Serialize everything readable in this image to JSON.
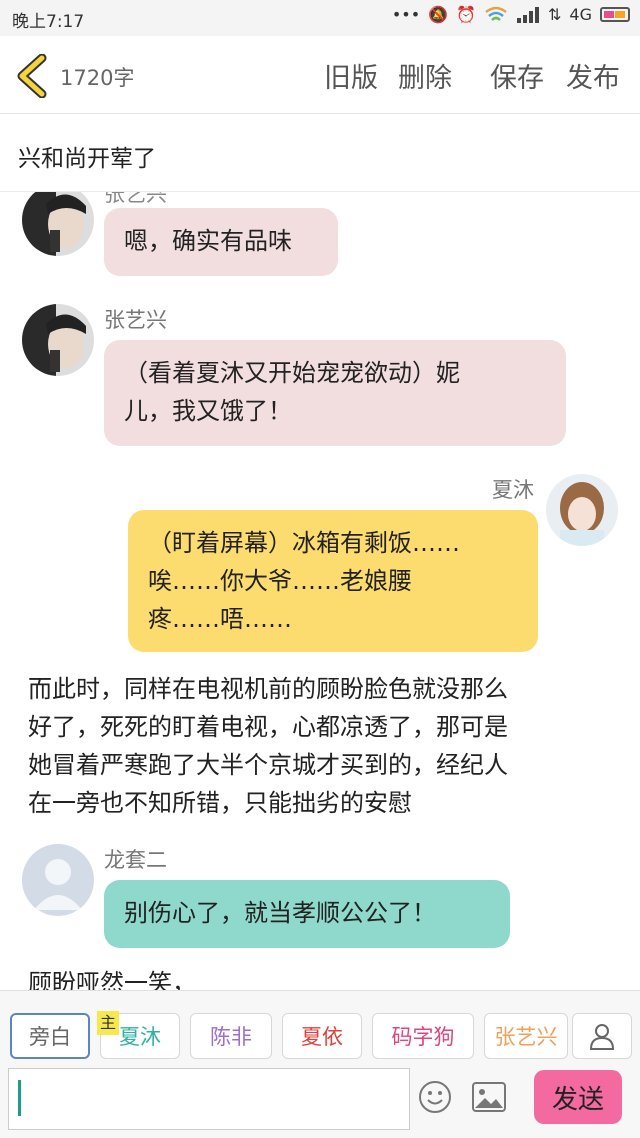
{
  "status": {
    "time": "晚上7:17",
    "network": "4G"
  },
  "header": {
    "word_count": "1720字",
    "old_version": "旧版",
    "delete": "删除",
    "save": "保存",
    "publish": "发布"
  },
  "title": "兴和尚开荤了",
  "messages": [
    {
      "type": "left",
      "speaker": "张艺兴",
      "text": "嗯，确实有品味",
      "color": "#f2dedf"
    },
    {
      "type": "left",
      "speaker": "张艺兴",
      "text_lines": [
        "（看着夏沐又开始宠宠欲动）妮",
        "儿，我又饿了！"
      ],
      "color": "#f2dedf"
    },
    {
      "type": "right",
      "speaker": "夏沐",
      "text_lines": [
        "（盯着屏幕）冰箱有剩饭……",
        "唉……你大爷……老娘腰",
        "疼……唔……"
      ],
      "color": "#fddc6f"
    },
    {
      "type": "narration",
      "text_lines": [
        "而此时，同样在电视机前的顾盼脸色就没那么",
        "好了，死死的盯着电视，心都凉透了，那可是",
        "她冒着严寒跑了大半个京城才买到的，经纪人",
        "在一旁也不知所错，只能拙劣的安慰"
      ]
    },
    {
      "type": "left",
      "speaker": "龙套二",
      "text": "别伤心了，就当孝顺公公了！",
      "color": "#8fd9cc"
    },
    {
      "type": "narration",
      "text": "顾盼哑然一笑，"
    }
  ],
  "roles": [
    {
      "label": "旁白",
      "color": "#666666",
      "selected": true
    },
    {
      "label": "夏沐",
      "color": "#2fb3a0",
      "badge": "主"
    },
    {
      "label": "陈非",
      "color": "#9b6fd1"
    },
    {
      "label": "夏依",
      "color": "#e0413a"
    },
    {
      "label": "码字狗",
      "color": "#e0457f"
    },
    {
      "label": "张艺兴",
      "color": "#f0a05a"
    }
  ],
  "input": {
    "placeholder": ""
  },
  "send_label": "发送",
  "icons": {
    "back": "chevron-left-icon",
    "add_role": "person-icon",
    "emoji": "smiley-icon",
    "image": "image-icon"
  }
}
